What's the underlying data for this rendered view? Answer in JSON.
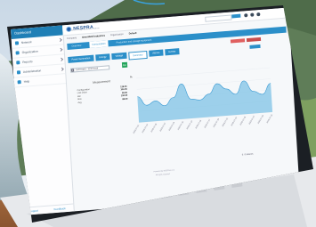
{
  "app": {
    "sidebar_title": "Dashboard",
    "logo_text": "NESPRA",
    "logo_subtitle": "Network Energy Supervision Platform",
    "company_label": "Company",
    "company_value": "Greenfield Industries",
    "site_label": "Organization",
    "site_value": "Default"
  },
  "sidebar": {
    "items": [
      {
        "label": "Network",
        "icon": "network-icon"
      },
      {
        "label": "Organization",
        "icon": "org-icon"
      },
      {
        "label": "Reports",
        "icon": "report-icon"
      },
      {
        "label": "Administration",
        "icon": "admin-icon"
      },
      {
        "label": "Help",
        "icon": "help-icon"
      }
    ],
    "footer_left": "Logout",
    "footer_right": "Feedback"
  },
  "tabs_primary": [
    {
      "label": "Overview"
    },
    {
      "label": "Consumption",
      "active": true
    },
    {
      "label": "Production and storage equipment"
    }
  ],
  "tabs_secondary": [
    {
      "label": "Power Generation"
    },
    {
      "label": "Energy"
    },
    {
      "label": "Voltage"
    },
    {
      "label": "Summary",
      "active": true
    },
    {
      "label": "Alarms"
    },
    {
      "label": "Events"
    }
  ],
  "filters": {
    "date_range": "01/07/2016 - 31/07/2016",
    "go_label": "Go"
  },
  "stats": {
    "title": "Measurement",
    "rows": [
      {
        "label": "Configuration",
        "value": "128.00"
      },
      {
        "label": "Last value",
        "value": "104.00"
      },
      {
        "label": "Min",
        "value": "38.00"
      },
      {
        "label": "Max",
        "value": "132.00"
      },
      {
        "label": "Avg",
        "value": "88.00"
      }
    ],
    "unit": "%"
  },
  "chart_data": {
    "type": "area",
    "title": "",
    "x": [
      "2016-07-01",
      "2016-07-03",
      "2016-07-05",
      "2016-07-07",
      "2016-07-09",
      "2016-07-11",
      "2016-07-13",
      "2016-07-15",
      "2016-07-17",
      "2016-07-19",
      "2016-07-21",
      "2016-07-23",
      "2016-07-25",
      "2016-07-27",
      "2016-07-29",
      "2016-07-31"
    ],
    "series": [
      {
        "values": [
          70,
          45,
          55,
          40,
          60,
          95,
          52,
          48,
          62,
          88,
          72,
          56,
          90,
          60,
          50,
          78
        ]
      }
    ],
    "ylim": [
      0,
      120
    ],
    "grid": true,
    "color": "#7fc3e6"
  },
  "footer": {
    "total_note": "0 / 0 alarms",
    "line1": "Powered by NESPRA v2.4",
    "line2": "All rights reserved"
  }
}
